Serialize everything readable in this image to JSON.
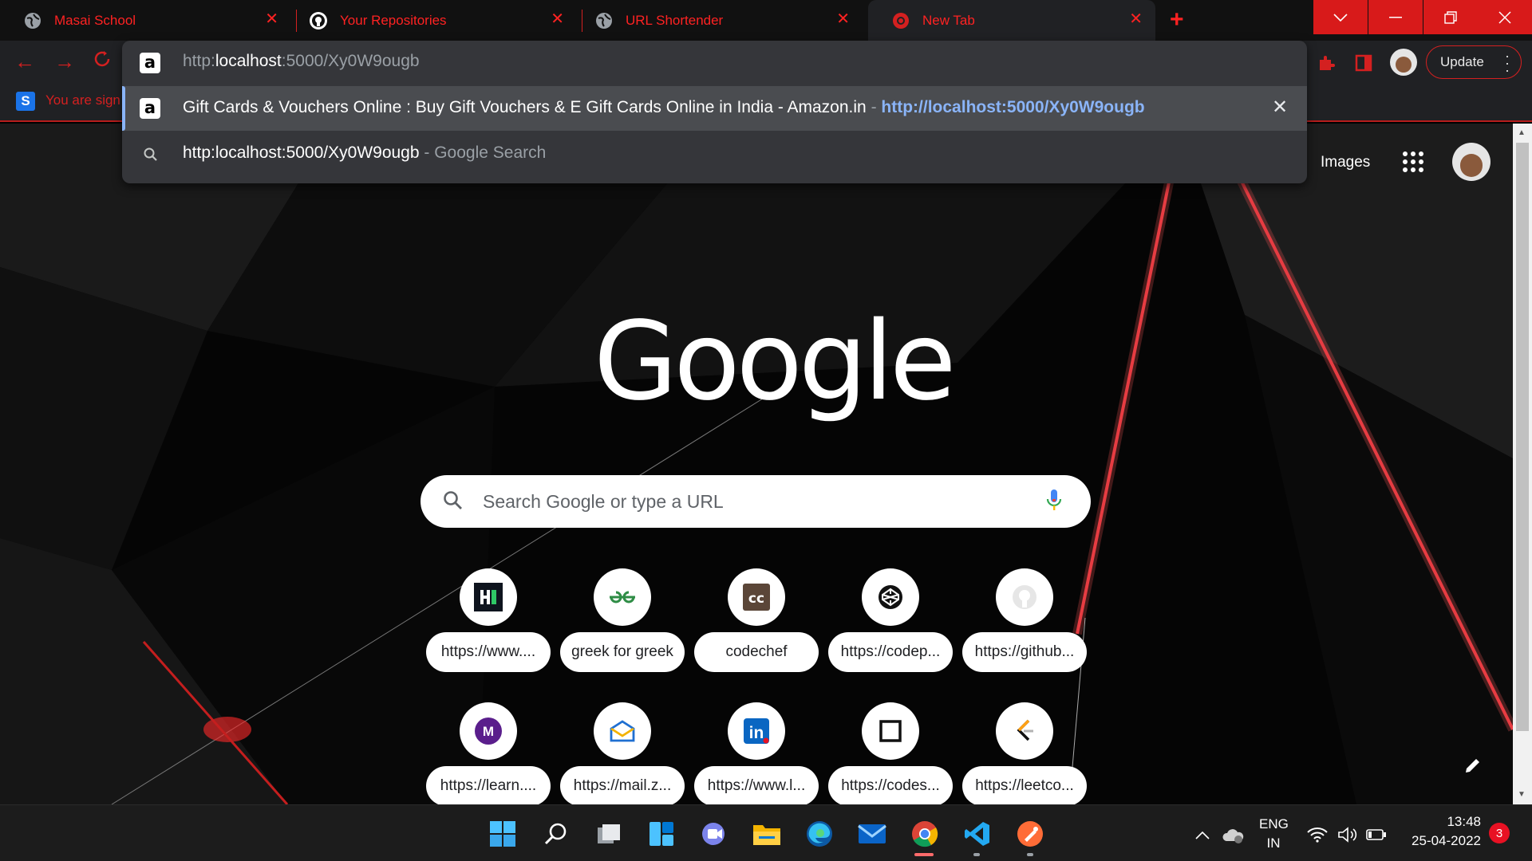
{
  "tabs": [
    {
      "title": "Masai School",
      "favicon": "globe-icon"
    },
    {
      "title": "Your Repositories",
      "favicon": "github-icon"
    },
    {
      "title": "URL Shortender",
      "favicon": "globe-icon"
    },
    {
      "title": "New Tab",
      "favicon": "chrome-icon"
    }
  ],
  "toolbar": {
    "update_label": "Update"
  },
  "bookmarks": {
    "items": [
      {
        "label": "You are sign",
        "icon": "s-icon"
      }
    ]
  },
  "omnibox": {
    "input_prefix": "http:",
    "input_highlight": "localhost",
    "input_suffix": ":5000/Xy0W9ougb",
    "suggestion_title": "Gift Cards & Vouchers Online : Buy Gift Vouchers & E Gift Cards Online in India - Amazon.in",
    "suggestion_separator": " - ",
    "suggestion_url": "http://localhost:5000/Xy0W9ougb",
    "search_query": "http:localhost:5000/Xy0W9ougb",
    "search_suffix": "Google Search"
  },
  "ntp": {
    "images_link": "Images",
    "logo_text": "Google",
    "search_placeholder": "Search Google or type a URL",
    "shortcuts": [
      {
        "label": "https://www....",
        "icon": "hackerrank-icon"
      },
      {
        "label": "greek for greek",
        "icon": "geeksforgeeks-icon"
      },
      {
        "label": "codechef",
        "icon": "codechef-icon"
      },
      {
        "label": "https://codep...",
        "icon": "codepen-icon"
      },
      {
        "label": "https://github...",
        "icon": "github-icon"
      },
      {
        "label": "https://learn....",
        "icon": "masai-icon"
      },
      {
        "label": "https://mail.z...",
        "icon": "zoho-mail-icon"
      },
      {
        "label": "https://www.l...",
        "icon": "linkedin-icon"
      },
      {
        "label": "https://codes...",
        "icon": "codesandbox-icon"
      },
      {
        "label": "https://leetco...",
        "icon": "leetcode-icon"
      }
    ]
  },
  "taskbar": {
    "lang_primary": "ENG",
    "lang_secondary": "IN",
    "time": "13:48",
    "date": "25-04-2022",
    "notification_count": "3"
  },
  "colors": {
    "accent_red": "#d42020",
    "omnibox_bg": "#35363a",
    "link_blue": "#8ab4f8"
  }
}
